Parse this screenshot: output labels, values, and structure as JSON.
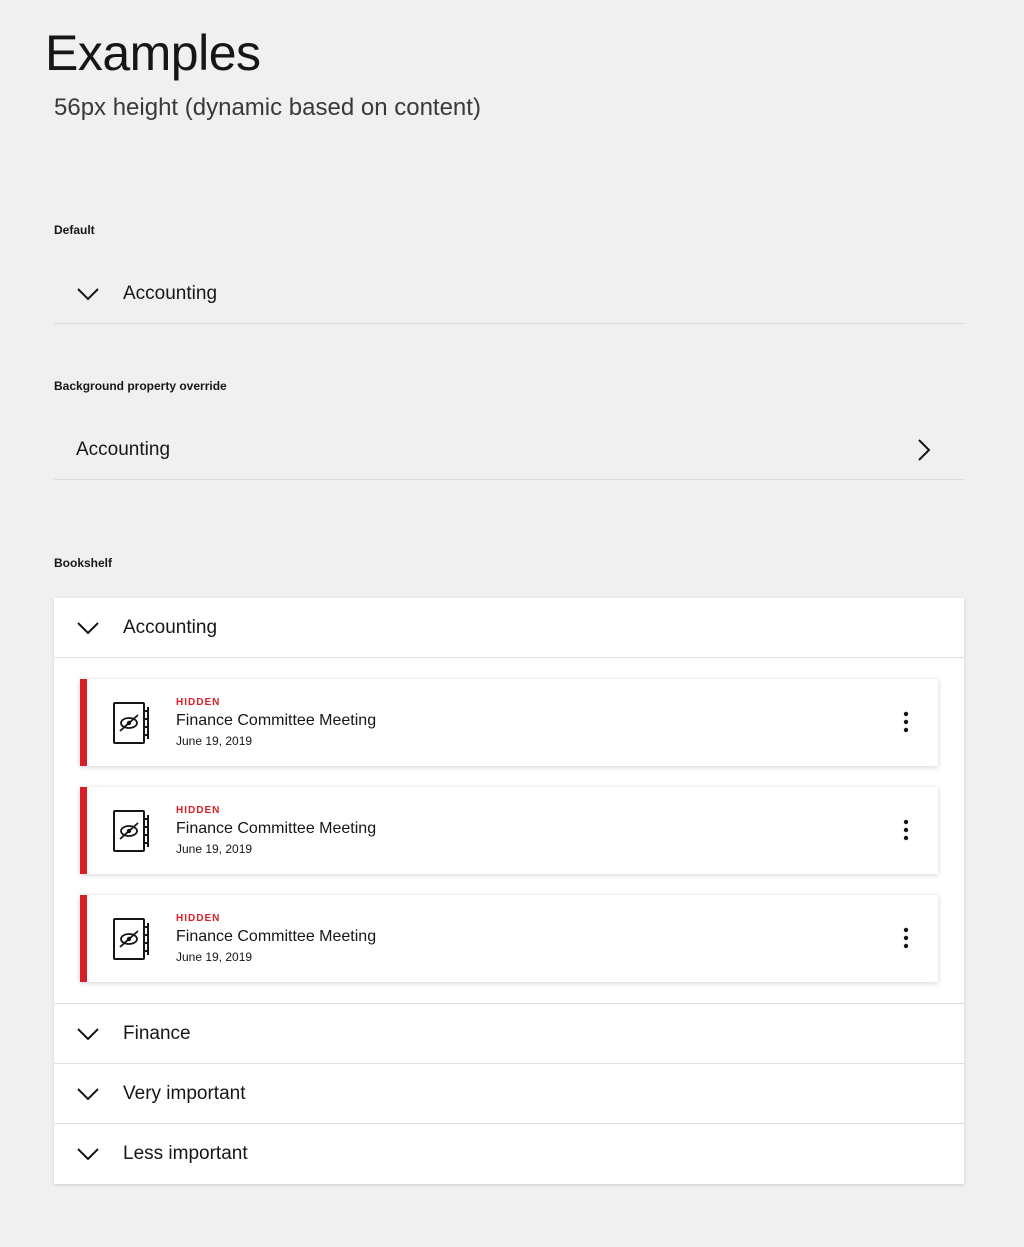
{
  "header": {
    "title": "Examples",
    "subtitle": "56px height (dynamic based on content)"
  },
  "sections": {
    "default": {
      "label": "Default",
      "item_label": "Accounting"
    },
    "override": {
      "label": "Background property override",
      "item_label": "Accounting"
    },
    "bookshelf": {
      "label": "Bookshelf",
      "expanded_label": "Accounting",
      "cards": [
        {
          "status": "HIDDEN",
          "title": "Finance Committee Meeting",
          "date": "June 19, 2019"
        },
        {
          "status": "HIDDEN",
          "title": "Finance Committee Meeting",
          "date": "June 19, 2019"
        },
        {
          "status": "HIDDEN",
          "title": "Finance Committee Meeting",
          "date": "June 19, 2019"
        }
      ],
      "collapsed": [
        {
          "label": "Finance"
        },
        {
          "label": "Very important"
        },
        {
          "label": "Less important"
        }
      ]
    }
  },
  "colors": {
    "accent": "#da1e28",
    "background": "#f0f0f0",
    "surface": "#ffffff",
    "text": "#161616"
  },
  "icons": {
    "chevron_down": "chevron-down-icon",
    "chevron_right": "chevron-right-icon",
    "document": "notebook-hidden-icon",
    "overflow": "overflow-menu-icon"
  }
}
